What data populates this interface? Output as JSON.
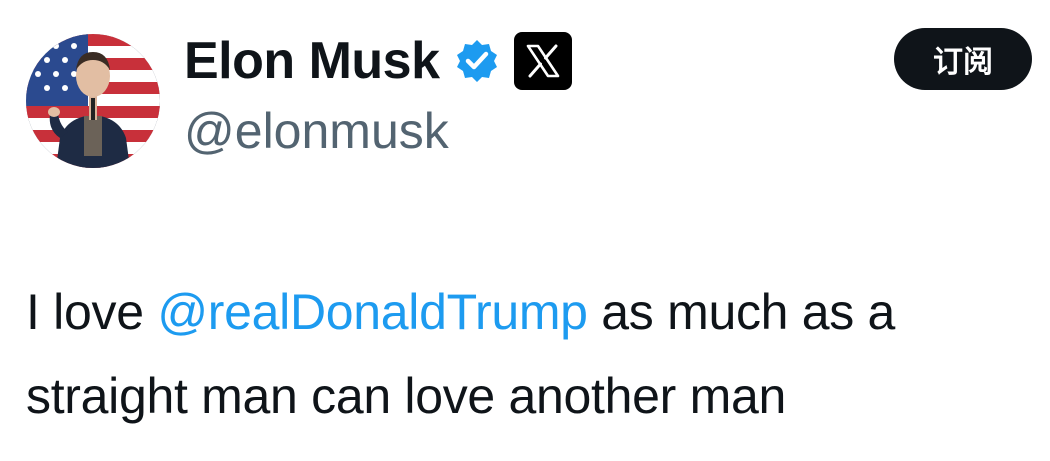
{
  "user": {
    "display_name": "Elon Musk",
    "handle": "@elonmusk",
    "verified_icon": "verified-badge-icon",
    "affiliation_icon": "x-logo-icon"
  },
  "actions": {
    "subscribe_label": "订阅"
  },
  "tweet": {
    "text_before": "I love ",
    "mention": "@realDonaldTrump",
    "text_after": " as much as a straight man can love another man"
  },
  "colors": {
    "text": "#0f1419",
    "secondary": "#536471",
    "link": "#1d9bf0",
    "verified": "#1d9bf0",
    "button_bg": "#0f1419",
    "button_text": "#ffffff"
  }
}
